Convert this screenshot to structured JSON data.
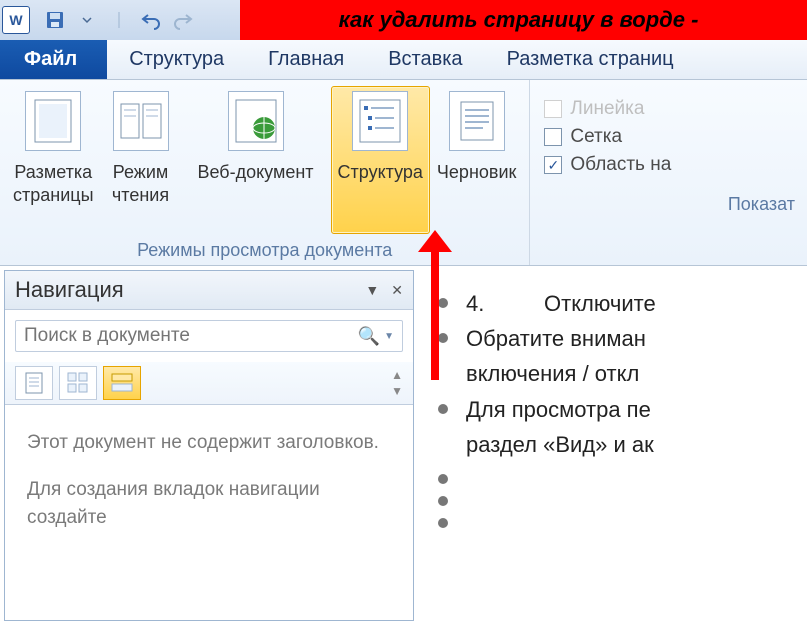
{
  "titlebar": {
    "doc_title": "как удалить страницу в ворде -",
    "app_letter": "W"
  },
  "tabs": {
    "file": "Файл",
    "t1": "Структура",
    "t2": "Главная",
    "t3": "Вставка",
    "t4": "Разметка страниц"
  },
  "ribbon": {
    "views": {
      "page_layout": "Разметка\nстраницы",
      "reading": "Режим\nчтения",
      "web": "Веб-документ",
      "outline": "Структура",
      "draft": "Черновик",
      "group_label": "Режимы просмотра документа"
    },
    "show": {
      "ruler": "Линейка",
      "grid": "Сетка",
      "navpane": "Область на",
      "group_label": "Показат"
    }
  },
  "nav": {
    "title": "Навигация",
    "search_placeholder": "Поиск в документе",
    "body_p1": "Этот документ не содержит заголовков.",
    "body_p2": "Для создания вкладок навигации создайте"
  },
  "doc": {
    "l1_num": "4.",
    "l1_text": "Отключите",
    "l2a": "Обратите вниман",
    "l2b": "включения / откл",
    "l3a": "Для просмотра пе",
    "l3b": "раздел «Вид» и ак"
  }
}
